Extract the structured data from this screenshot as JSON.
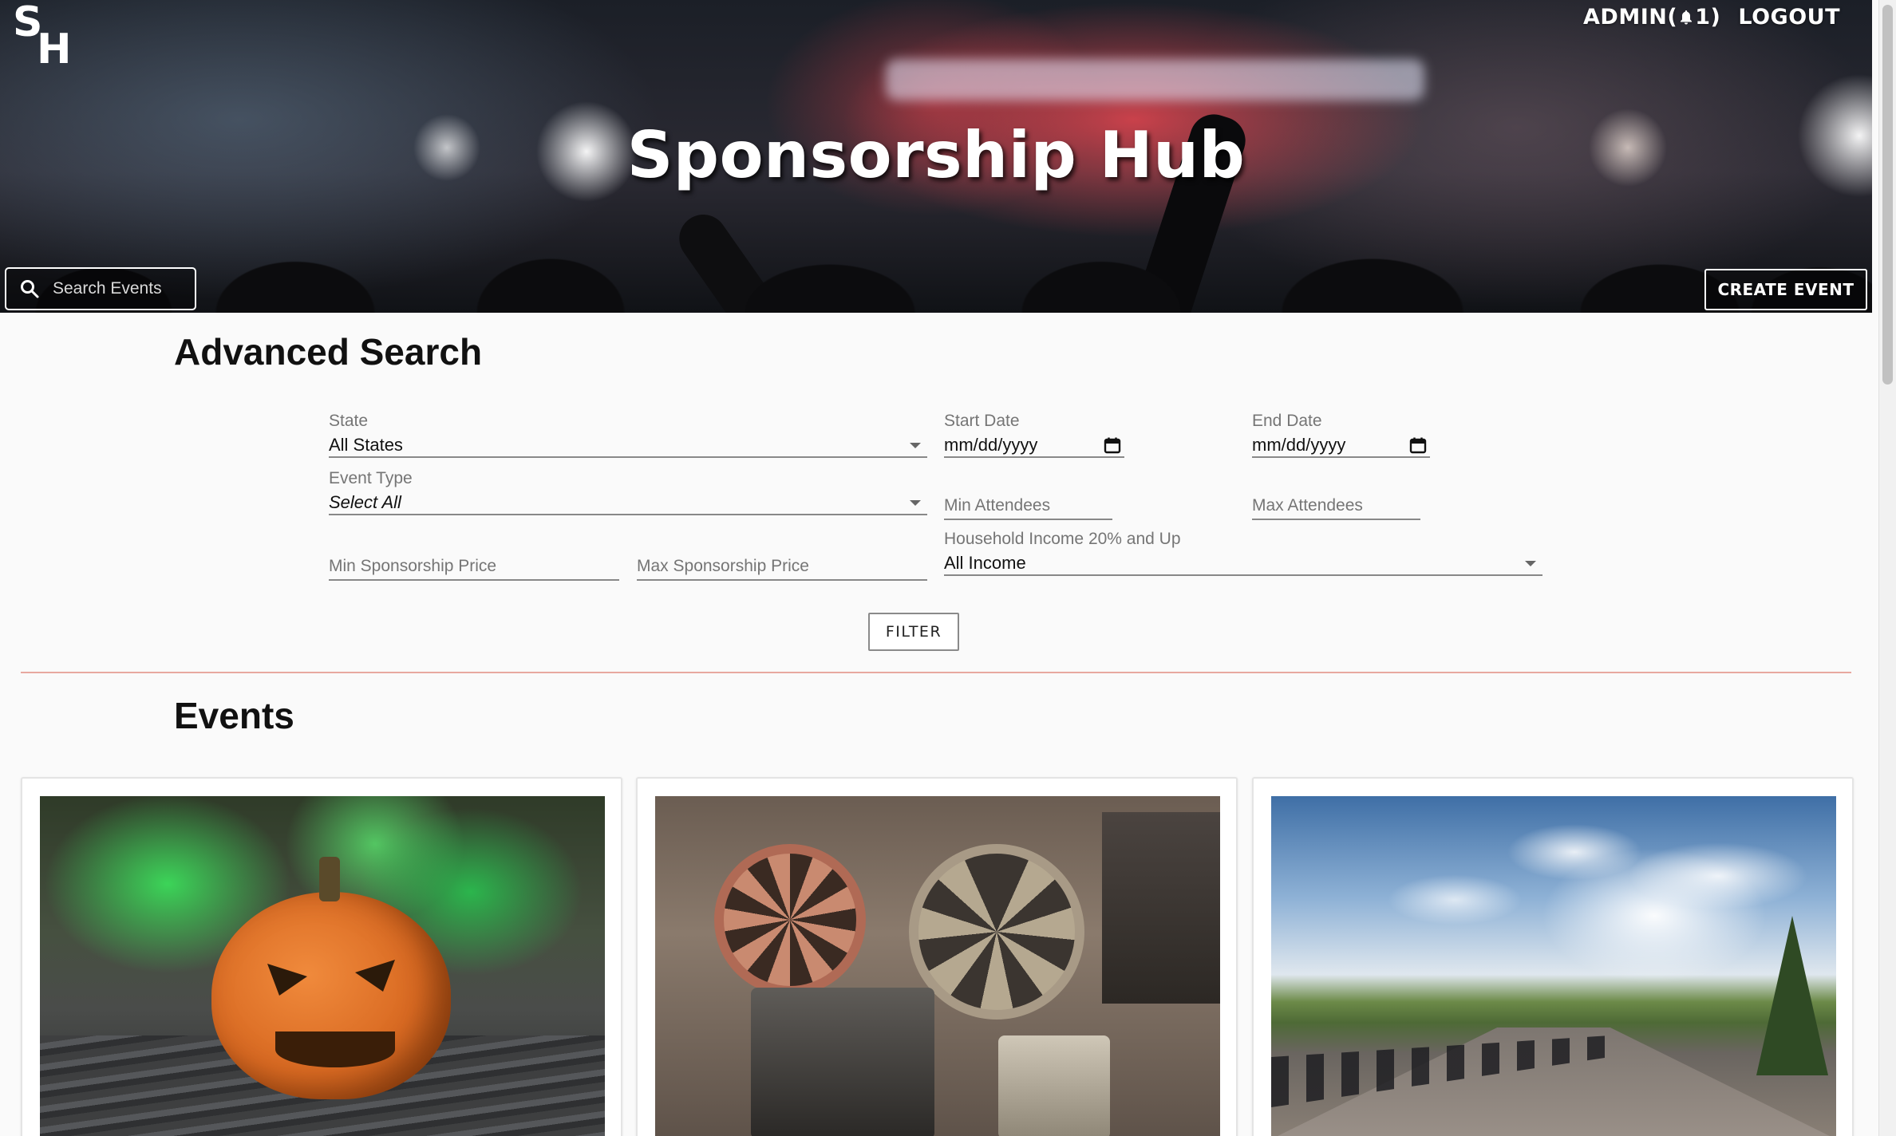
{
  "header": {
    "logo_top": "S",
    "logo_bottom": "H",
    "title": "Sponsorship Hub",
    "admin_prefix": "ADMIN(",
    "admin_count": "1",
    "admin_suffix": ")",
    "logout_label": "LOGOUT",
    "search_placeholder": "Search Events",
    "create_event_label": "CREATE EVENT"
  },
  "advanced_search": {
    "title": "Advanced Search",
    "state": {
      "label": "State",
      "value": "All States"
    },
    "start_date": {
      "label": "Start Date",
      "value": "mm/dd/yyyy"
    },
    "end_date": {
      "label": "End Date",
      "value": "mm/dd/yyyy"
    },
    "event_type": {
      "label": "Event Type",
      "value": "Select All"
    },
    "min_attendees": {
      "placeholder": "Min Attendees"
    },
    "max_attendees": {
      "placeholder": "Max Attendees"
    },
    "household_income": {
      "label": "Household Income 20% and Up",
      "value": "All Income"
    },
    "min_price": {
      "placeholder": "Min Sponsorship Price"
    },
    "max_price": {
      "placeholder": "Max Sponsorship Price"
    },
    "filter_label": "FILTER"
  },
  "events": {
    "title": "Events",
    "cards": [
      {
        "image": "halloween-pumpkin-photo"
      },
      {
        "image": "film-projector-photo"
      },
      {
        "image": "motorcycle-rally-photo"
      }
    ]
  },
  "colors": {
    "divider": "#e8a8a0",
    "background": "#fafafa",
    "label_gray": "#757575"
  }
}
